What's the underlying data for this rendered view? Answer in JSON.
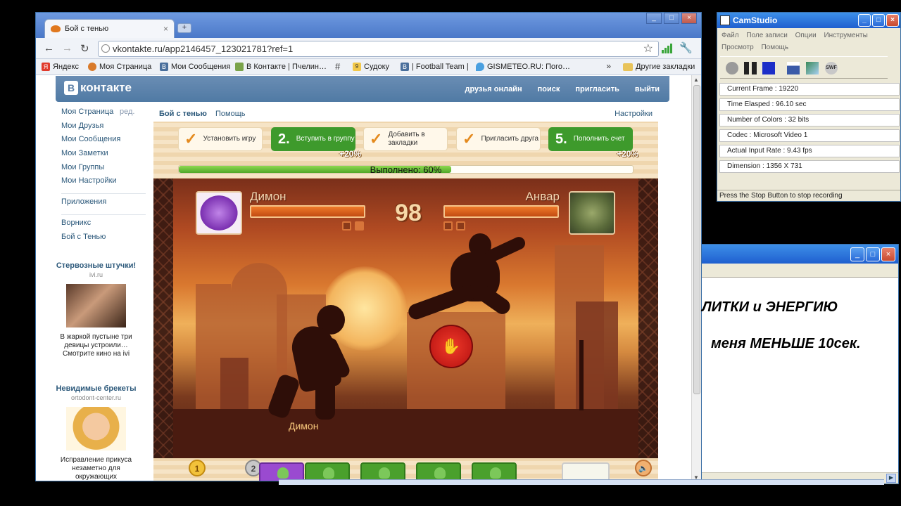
{
  "browser": {
    "tab_title": "Бой с тенью",
    "tab_close": "×",
    "new_tab": "+",
    "url": "vkontakte.ru/app2146457_123021781?ref=1",
    "window_buttons": [
      "_",
      "□",
      "×"
    ],
    "bookmarks": [
      {
        "label": "Яндекс",
        "icon": "yandex-icon"
      },
      {
        "label": "Моя Страница",
        "icon": "paw-icon"
      },
      {
        "label": "Мои Сообщения",
        "icon": "vk-icon"
      },
      {
        "label": "В Контакте | Пчелин…",
        "icon": "image-icon"
      },
      {
        "label": "",
        "icon": "hash-icon"
      },
      {
        "label": "Судоку",
        "icon": "sudoku-icon"
      },
      {
        "label": "| Football Team |",
        "icon": "vk-icon"
      },
      {
        "label": "GISMETEO.RU: Пого…",
        "icon": "drop-icon"
      }
    ],
    "bookmarks_more": "»",
    "other_bookmarks": "Другие закладки"
  },
  "vk": {
    "logo_letter": "B",
    "logo_text": "контакте",
    "nav": [
      "друзья онлайн",
      "поиск",
      "пригласить",
      "выйти"
    ],
    "menu": [
      "Моя Страница",
      "Мои Друзья",
      "Мои Сообщения",
      "Мои Заметки",
      "Мои Группы",
      "Мои Настройки"
    ],
    "menu_edit": "ред.",
    "apps_menu": [
      "Приложения"
    ],
    "games_menu": [
      "Ворникс",
      "Бой с Тенью"
    ],
    "ads": [
      {
        "title": "Стервозные штучки!",
        "domain": "ivi.ru",
        "desc": "В жаркой пустыне три девицы устроили… Смотрите кино на ivi"
      },
      {
        "title": "Невидимые брекеты",
        "domain": "ortodont-center.ru",
        "desc": "Исправление прикуса незаметно для окружающих"
      }
    ]
  },
  "app": {
    "name": "Бой с тенью",
    "help": "Помощь",
    "settings": "Настройки",
    "tasks": [
      {
        "kind": "done",
        "mark": "✓",
        "label": "Установить игру",
        "bonus": ""
      },
      {
        "kind": "todo",
        "mark": "2.",
        "label": "Вступить в группу",
        "bonus": "+20%"
      },
      {
        "kind": "done",
        "mark": "✓",
        "label": "Добавить в закладки",
        "bonus": ""
      },
      {
        "kind": "done",
        "mark": "✓",
        "label": "Пригласить друга",
        "bonus": ""
      },
      {
        "kind": "todo",
        "mark": "5.",
        "label": "Пополнить счет",
        "bonus": "+20%"
      }
    ],
    "progress_text": "Выполнено: 60%",
    "progress_value": 0.6
  },
  "game": {
    "player_left": "Димон",
    "player_right": "Анвар",
    "timer": "98",
    "health_left": 1.0,
    "health_right": 1.0,
    "hit_icon": "✋",
    "floor_label": "Димон",
    "coins": [
      "1",
      "2"
    ]
  },
  "camstudio": {
    "title": "CamStudio",
    "menu_row1": [
      "Файл",
      "Поле записи",
      "Опции",
      "Инструменты"
    ],
    "menu_row2": [
      "Просмотр",
      "Помощь"
    ],
    "swf_label": "SWF",
    "stats": [
      "Current Frame : 19220",
      "Time Elasped : 96.10 sec",
      "Number of Colors : 32 bits",
      "Codec : Microsoft Video 1",
      "Actual Input Rate : 9.43 fps",
      "Dimension : 1356 X 731"
    ],
    "status": "Press the Stop Button to stop recording"
  },
  "textwindow": {
    "line1": "ЛИТКИ и ЭНЕРГИЮ",
    "line2": "меня МЕНЬШЕ 10сек."
  },
  "colors": {
    "vk_blue": "#5b7fa6",
    "task_green": "#3e9a2c",
    "hit_red": "#d81e1e"
  }
}
